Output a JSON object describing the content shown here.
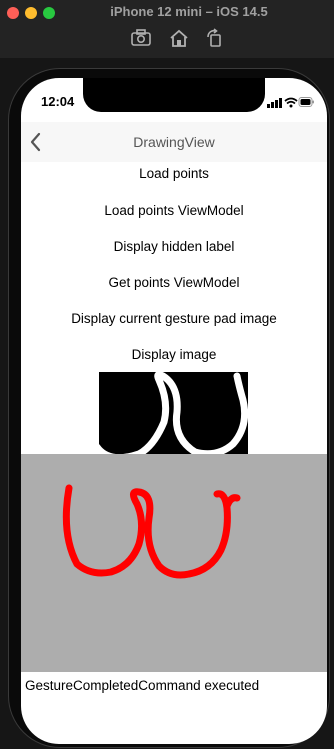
{
  "window": {
    "title": "iPhone 12 mini – iOS 14.5"
  },
  "toolbar": {
    "icons": [
      "screenshot-icon",
      "home-icon",
      "rotate-icon"
    ]
  },
  "status_bar": {
    "time": "12:04"
  },
  "nav": {
    "title": "DrawingView"
  },
  "buttons": [
    "Load points",
    "Load points ViewModel",
    "Display hidden label",
    "Get points ViewModel",
    "Display current gesture pad image",
    "Display image"
  ],
  "gesture_pad": {
    "background": "#adadad",
    "stroke_color": "#ff0000"
  },
  "image_view": {
    "background": "#000000",
    "stroke_color": "#ffffff"
  },
  "status_label": "GestureCompletedCommand executed"
}
